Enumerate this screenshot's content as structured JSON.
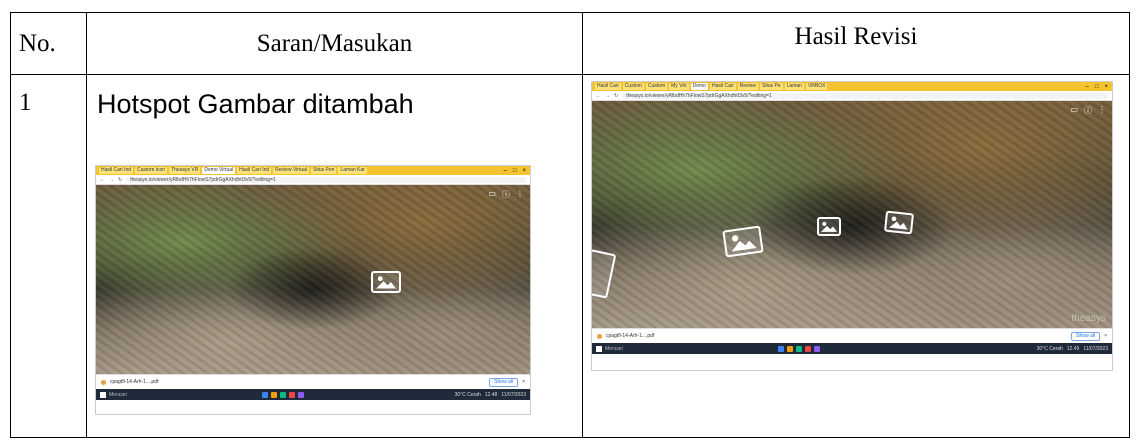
{
  "table": {
    "headers": [
      "No.",
      "Saran/Masukan",
      "Hasil Revisi"
    ],
    "rows": [
      {
        "no": "1",
        "saran": "Hotspot Gambar ditambah"
      }
    ]
  },
  "screenshot_before": {
    "tabs": [
      "Hasil Cari Ind",
      "Custom Icon",
      "Theasys VR",
      "Demo Virtual",
      "Hasil Cari Ind",
      "Review Virtual",
      "Situs Pen",
      "Laman Kar"
    ],
    "url": "theasys.io/viewer/yRlbdHh7hFlowS7pdrGgAXhdhtI3v5/?editing=1",
    "download_file": "cpagtfl-14-Arh-1....pdf",
    "show_all": "Show all",
    "search": "Mencari",
    "weather": "30°C Cerah",
    "time": "12.48",
    "date": "11/07/2023"
  },
  "screenshot_after": {
    "tabs": [
      "Hasil Cari",
      "Custom",
      "Custom",
      "My Virt",
      "Demo",
      "Hasil Cari",
      "Review",
      "Situs Pe",
      "Laman",
      "VRBOX"
    ],
    "url": "theasys.io/viewer/yRlbdHh7hFlowS7pdrGgAXhdhtI3v5/?editing=1",
    "download_file": "cpagtfl-14-Arh-1....pdf",
    "show_all": "Show all",
    "search": "Mencari",
    "weather": "30°C Cerah",
    "time": "12.49",
    "date": "11/07/2023",
    "watermark": "theasys"
  },
  "colors": {
    "chrome_tabbar": "#f4c430",
    "taskbar": "#1f2a3b",
    "hotspot_border": "#ffffff"
  },
  "icons": [
    "image-hotspot-icon",
    "windows-start-icon",
    "download-file-icon"
  ]
}
